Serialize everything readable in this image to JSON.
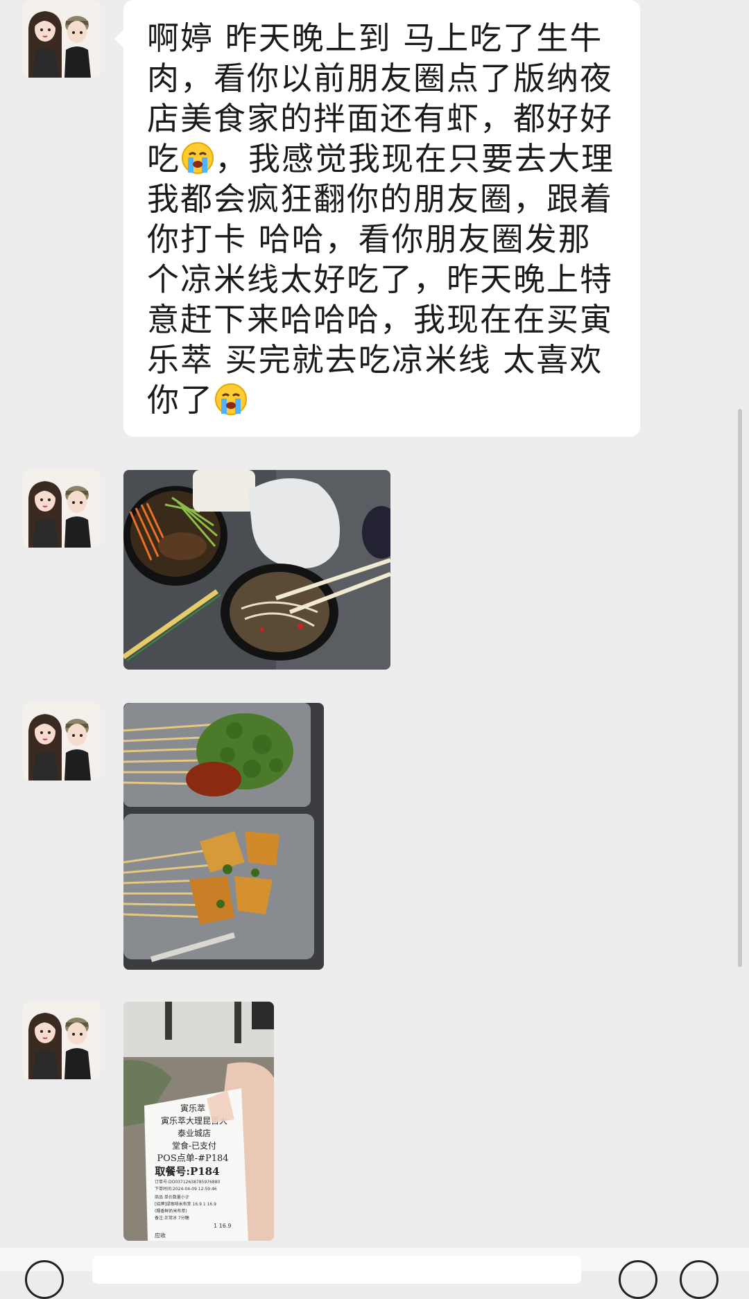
{
  "chat": {
    "messages": [
      {
        "type": "text",
        "sender_avatar": "couple-avatar",
        "segments": [
          "啊婷 昨天晚上到 马上吃了生牛肉，看你以前朋友圈点了版纳夜店美食家的拌面还有虾，都好好吃",
          "，我感觉我现在只要去大理我都会疯狂翻你的朋友圈，跟着你打卡 哈哈，看你朋友圈发那个凉米线太好吃了，昨天晚上特意赶下来哈哈哈，我现在在买寅乐萃 买完就去吃凉米线 太喜欢你了"
        ],
        "emojis": [
          "crying-face-emoji",
          "crying-face-emoji"
        ]
      },
      {
        "type": "image",
        "sender_avatar": "couple-avatar",
        "subject": "food-photo-noodles"
      },
      {
        "type": "image",
        "sender_avatar": "couple-avatar",
        "subject": "food-photo-skewers"
      },
      {
        "type": "image",
        "sender_avatar": "couple-avatar",
        "subject": "receipt-photo"
      }
    ]
  },
  "receipt": {
    "shop": "寅乐萃",
    "branch_line1": "寅乐萃大理昆百大",
    "branch_line2": "泰业城店",
    "dine_status": "堂食-已支付",
    "pos_order": "POS点单-#P184",
    "pickup_no": "取餐号:P184",
    "order_no": "订单号:DO03712638785976880",
    "order_time": "下单时间:2024-04-09 12:59:46",
    "col_headers": "商品  单价数量小计",
    "item1": "[招牌]绿咖啡米布萃  16.9 1  16.9",
    "item2": "(糯香鲜奶米布萃)",
    "item_note": "备注:正常冰 7分糖",
    "total_line": "1  16.9",
    "footer": "应收"
  },
  "colors": {
    "background": "#ededed",
    "bubble": "#ffffff",
    "text": "#1a1a1a"
  }
}
